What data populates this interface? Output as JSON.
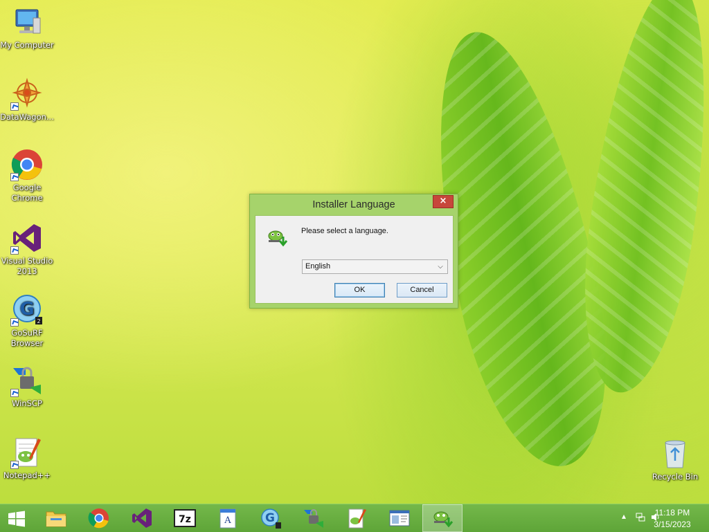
{
  "desktop": {
    "icons": [
      {
        "label": "My Computer",
        "icon": "computer-icon"
      },
      {
        "label": "DataWagon...",
        "icon": "datawagon-icon"
      },
      {
        "label": "Google Chrome",
        "icon": "chrome-icon"
      },
      {
        "label": "Visual Studio 2013",
        "icon": "visual-studio-icon"
      },
      {
        "label": "GoSuRF Browser",
        "icon": "gosurf-icon"
      },
      {
        "label": "WinSCP",
        "icon": "winscp-icon"
      },
      {
        "label": "Notepad++",
        "icon": "notepadpp-icon"
      },
      {
        "label": "Recycle Bin",
        "icon": "recycle-bin-icon"
      }
    ]
  },
  "dialog": {
    "title": "Installer Language",
    "close_label": "×",
    "prompt": "Please select a language.",
    "selected_language": "English",
    "ok_label": "OK",
    "cancel_label": "Cancel"
  },
  "taskbar": {
    "items": [
      {
        "icon": "windows-start-icon"
      },
      {
        "icon": "file-explorer-icon"
      },
      {
        "icon": "chrome-icon"
      },
      {
        "icon": "visual-studio-icon"
      },
      {
        "icon": "7zip-icon",
        "label": "7z"
      },
      {
        "icon": "wordpad-icon"
      },
      {
        "icon": "gosurf-icon"
      },
      {
        "icon": "winscp-icon"
      },
      {
        "icon": "notepadpp-icon"
      },
      {
        "icon": "window-app-icon"
      },
      {
        "icon": "notepadpp-installer-icon"
      }
    ],
    "clock_time": "11:18 PM",
    "clock_date": "3/15/2023"
  },
  "colors": {
    "taskbar": "#66ab3e",
    "dialog_frame": "#a6d36b",
    "close_button": "#c7473b"
  }
}
